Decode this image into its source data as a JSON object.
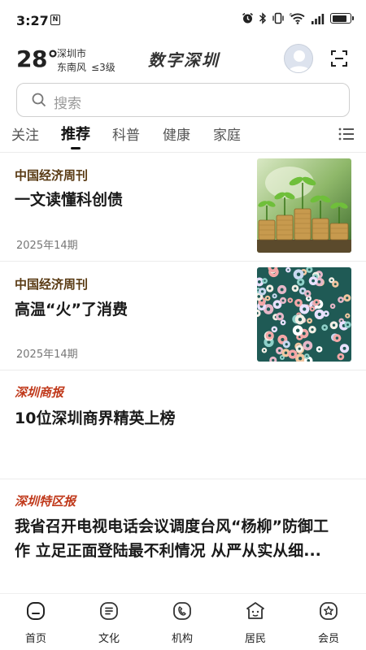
{
  "status_bar": {
    "time": "3:27",
    "nfc_glyph": "N",
    "icons": [
      "alarm-icon",
      "bluetooth-icon",
      "vibrate-icon",
      "wifi-icon",
      "signal-icon",
      "battery-icon"
    ],
    "battery_level": 0.85
  },
  "header": {
    "temperature": "28°",
    "city": "深圳市",
    "wind": "东南风",
    "wind_level": "≤3级",
    "brand": "数字深圳"
  },
  "search": {
    "placeholder": "搜索"
  },
  "tabs": [
    {
      "label": "关注",
      "active": false
    },
    {
      "label": "推荐",
      "active": true
    },
    {
      "label": "科普",
      "active": false
    },
    {
      "label": "健康",
      "active": false
    },
    {
      "label": "家庭",
      "active": false
    }
  ],
  "articles": [
    {
      "source": "中国经济周刊",
      "title": "一文读懂科创债",
      "date": "2025年14期"
    },
    {
      "source": "中国经济周刊",
      "title": "高温“火”了消费",
      "date": "2025年14期"
    },
    {
      "source": "深圳商报",
      "title": "10位深圳商界精英上榜"
    },
    {
      "source": "深圳特区报",
      "title_line1": "我省召开电视电话会议调度台风“杨柳”防御工",
      "title_line2": "作 立足正面登陆最不利情况 从严从实从细..."
    }
  ],
  "bottom_nav": [
    {
      "label": "首页",
      "icon": "home-icon"
    },
    {
      "label": "文化",
      "icon": "culture-icon"
    },
    {
      "label": "机构",
      "icon": "institution-icon"
    },
    {
      "label": "居民",
      "icon": "resident-icon"
    },
    {
      "label": "会员",
      "icon": "member-icon"
    }
  ]
}
